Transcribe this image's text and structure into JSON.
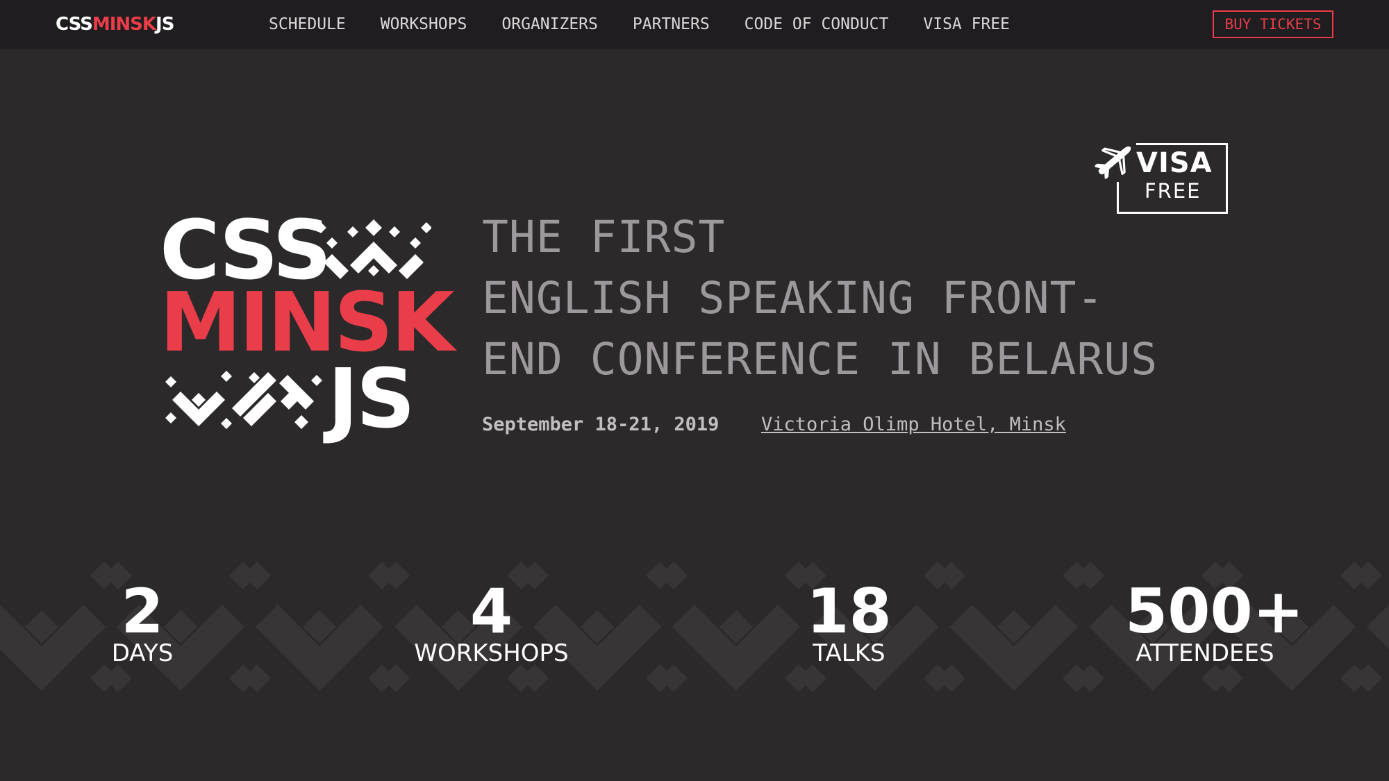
{
  "nav": {
    "brand": {
      "part1": "CSS",
      "part2": "MINSK",
      "part3": "JS"
    },
    "links": [
      "SCHEDULE",
      "WORKSHOPS",
      "ORGANIZERS",
      "PARTNERS",
      "CODE OF CONDUCT",
      "VISA FREE"
    ],
    "buy_label": "BUY TICKETS"
  },
  "badge": {
    "word": "VISA",
    "sub": "FREE",
    "icon": "airplane-icon"
  },
  "logo": {
    "line1": "CSS",
    "line2": "MINSK",
    "line3": "JS"
  },
  "hero": {
    "lines": [
      "THE FIRST",
      "ENGLISH SPEAKING FRONT-",
      "END CONFERENCE IN BELARUS"
    ],
    "date": "September 18-21, 2019",
    "venue": "Victoria Olimp Hotel, Minsk"
  },
  "stats": [
    {
      "value": "2",
      "label": "DAYS"
    },
    {
      "value": "4",
      "label": "WORKSHOPS"
    },
    {
      "value": "18",
      "label": "TALKS"
    },
    {
      "value": "500+",
      "label": "ATTENDEES"
    }
  ],
  "colors": {
    "background": "#2c292b",
    "nav_background": "#1f1d1f",
    "accent": "#ea3d4a",
    "headline": "#9d989b",
    "pattern": "#383537"
  }
}
